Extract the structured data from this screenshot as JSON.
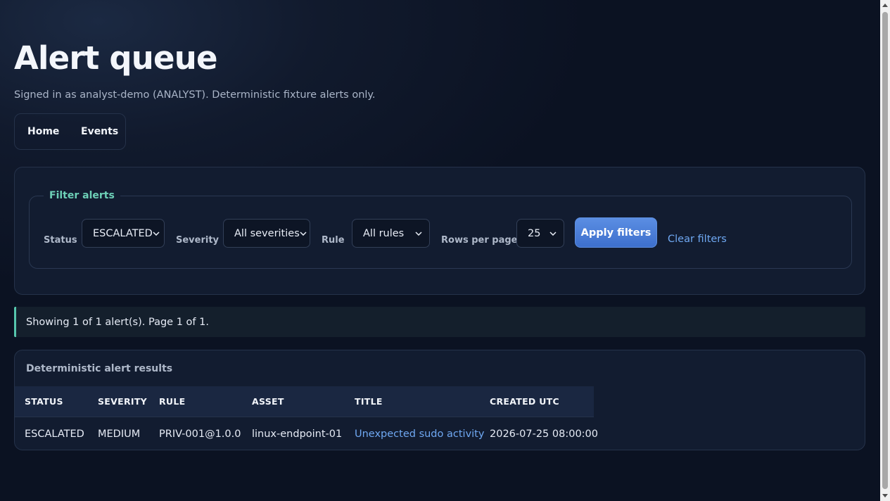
{
  "header": {
    "title": "Alert queue",
    "subtitle": "Signed in as analyst-demo (ANALYST). Deterministic fixture alerts only."
  },
  "nav": {
    "items": [
      {
        "label": "Home"
      },
      {
        "label": "Events"
      }
    ]
  },
  "filters": {
    "legend": "Filter alerts",
    "status": {
      "label": "Status",
      "value": "ESCALATED"
    },
    "severity": {
      "label": "Severity",
      "value": "All severities"
    },
    "rule": {
      "label": "Rule",
      "value": "All rules"
    },
    "rows_per_page": {
      "label": "Rows per page",
      "value": "25"
    },
    "apply_label": "Apply filters",
    "clear_label": "Clear filters"
  },
  "notice": "Showing 1 of 1 alert(s). Page 1 of 1.",
  "results": {
    "title": "Deterministic alert results",
    "columns": [
      "STATUS",
      "SEVERITY",
      "RULE",
      "ASSET",
      "TITLE",
      "CREATED UTC"
    ],
    "rows": [
      {
        "status": "ESCALATED",
        "severity": "MEDIUM",
        "rule": "PRIV-001@1.0.0",
        "asset": "linux-endpoint-01",
        "title": "Unexpected sudo activity",
        "created": "2026-07-25 08:00:00"
      }
    ]
  },
  "colors": {
    "accent": "#6dd0b7",
    "primary": "#4a7fd8",
    "link": "#6fa8f2",
    "background": "#0b1222"
  }
}
